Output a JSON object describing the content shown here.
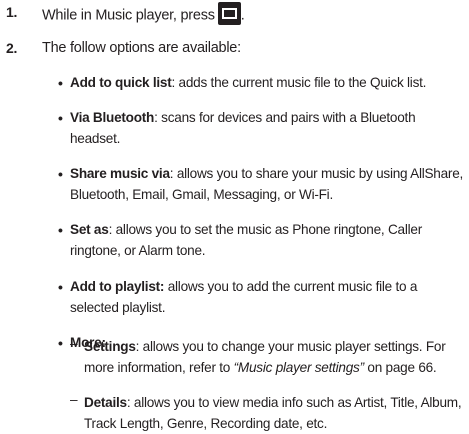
{
  "steps": [
    {
      "number": "1.",
      "text": "While in Music player, press",
      "icon": "menu-key-icon",
      "suffix": "."
    },
    {
      "number": "2.",
      "text": "The follow options are available:"
    }
  ],
  "options": [
    {
      "term": "Add to quick list",
      "desc": ": adds the current music file to the Quick list."
    },
    {
      "term": "Via Bluetooth",
      "desc": ": scans for devices and pairs with a Bluetooth headset."
    },
    {
      "term": "Share music via",
      "desc": ": allows you to share your music by using AllShare, Bluetooth, Email, Gmail, Messaging, or Wi-Fi."
    },
    {
      "term": "Set as",
      "desc": ": allows you to set the music as Phone ringtone, Caller ringtone, or Alarm tone."
    },
    {
      "term": "Add to playlist:",
      "desc": " allows you to add the current music file to a selected playlist."
    },
    {
      "term": "More:",
      "desc": ""
    }
  ],
  "more_items": [
    {
      "term": "Settings",
      "desc": ": allows you to change your music player settings. For more information, refer to ",
      "ref": "“Music player settings”",
      "after": " on page 66."
    },
    {
      "term": "Details",
      "desc": ": allows you to view media info such as Artist, Title, Album, Track Length, Genre, Recording date, etc."
    }
  ],
  "bullet_glyph": "•",
  "dash_glyph": "–"
}
